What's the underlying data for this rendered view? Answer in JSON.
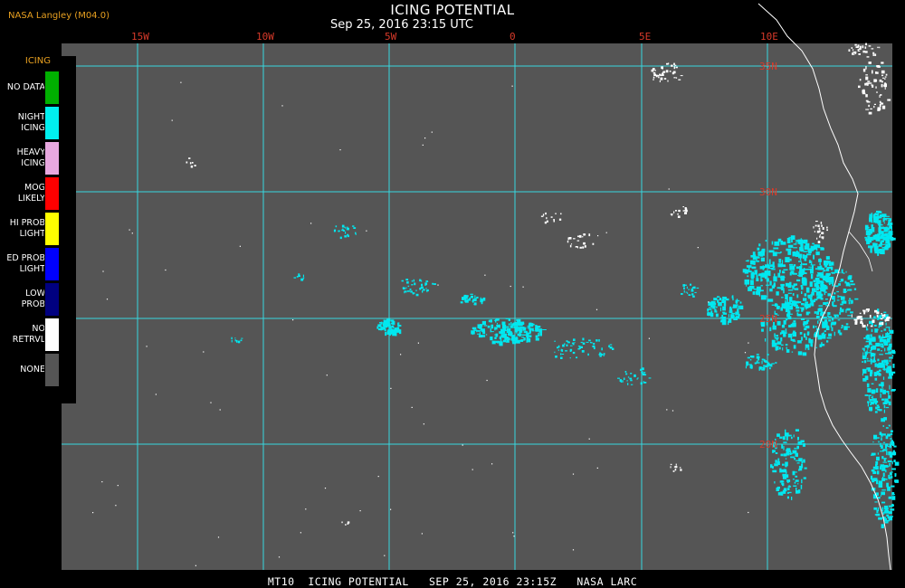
{
  "header": {
    "title": "ICING POTENTIAL",
    "subtitle": "Sep 25, 2016 23:15 UTC",
    "producer": "NASA Langley (M04.0)"
  },
  "map": {
    "longitude_labels": [
      "15W",
      "10W",
      "5W",
      "0",
      "5E",
      "10E"
    ],
    "latitude_labels": [
      "35N",
      "30N",
      "25N",
      "20N"
    ],
    "colors": {
      "background": "#555555",
      "grid": "#38d8e0",
      "coastline": "#ffffff",
      "latitude_label": "#d83a2a",
      "icing_cells": "#00e8f0",
      "no_retrieval": "#ffffff"
    }
  },
  "legend": {
    "heading": "ICING",
    "items": [
      {
        "label": "NO DATA",
        "color": "#00b000"
      },
      {
        "label": "NIGHT\nICING",
        "color": "#00f0f0"
      },
      {
        "label": "HEAVY\nICING",
        "color": "#e8a8e0"
      },
      {
        "label": "MOG\nLIKELY",
        "color": "#ff0000"
      },
      {
        "label": "HI PROB\nLIGHT",
        "color": "#ffff00"
      },
      {
        "label": "ED PROB\nLIGHT",
        "color": "#0000ff"
      },
      {
        "label": "LOW\nPROB",
        "color": "#000080"
      },
      {
        "label": "NO\nRETRVL",
        "color": "#ffffff"
      },
      {
        "label": "NONE",
        "color": "#555555"
      }
    ]
  },
  "footer": {
    "caption": "MT10  ICING POTENTIAL   SEP 25, 2016 23:15Z   NASA LARC"
  }
}
